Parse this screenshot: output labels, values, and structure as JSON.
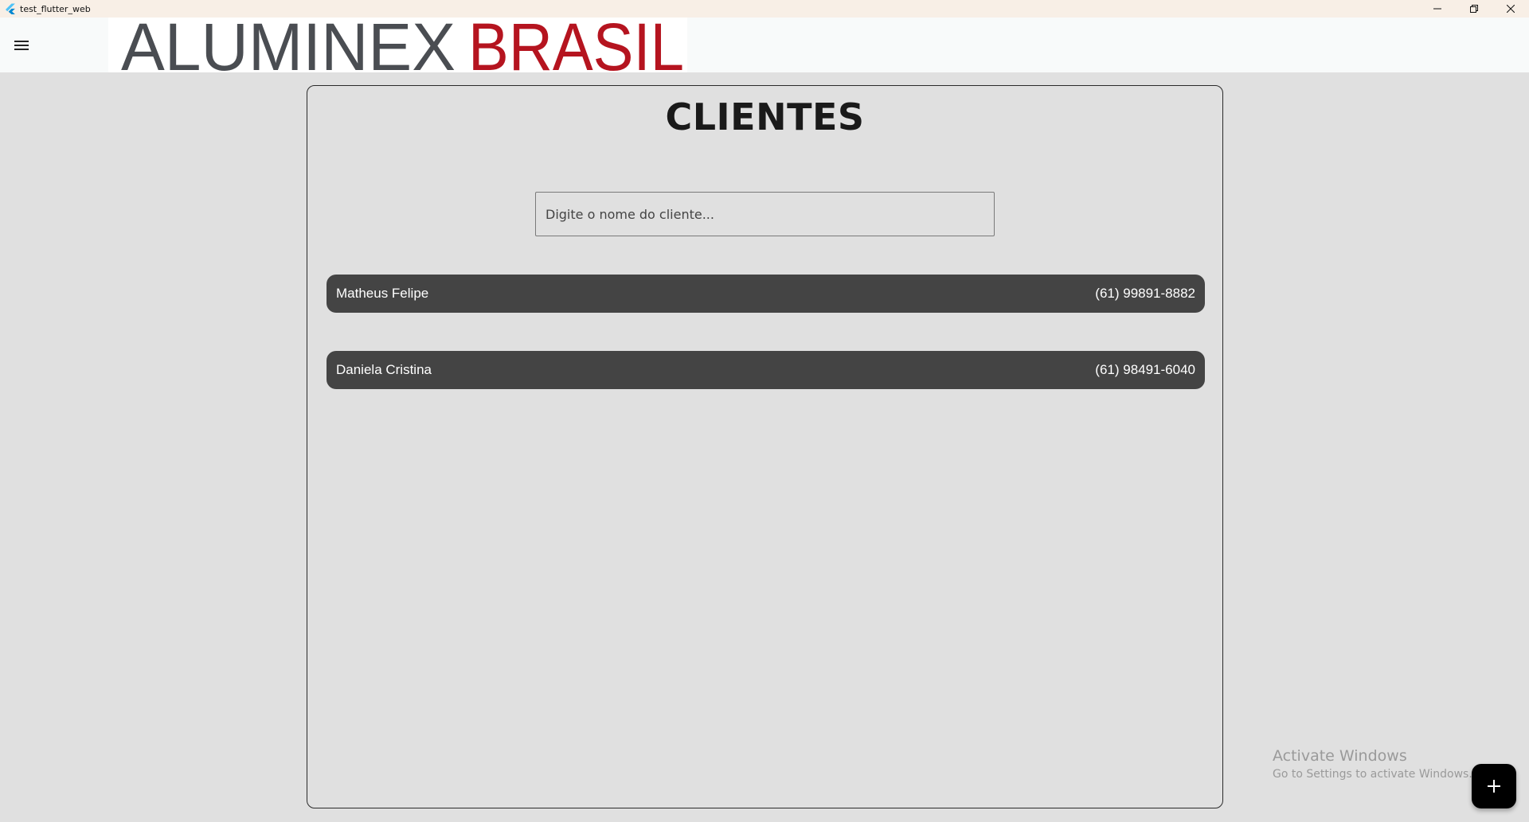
{
  "window": {
    "title": "test_flutter_web"
  },
  "appbar": {
    "menu_icon": "hamburger-menu-icon",
    "logo": {
      "part1": "ALUMINEX",
      "part2": "BRASIL",
      "color1": "#4a4d52",
      "color2": "#b5141f"
    }
  },
  "main": {
    "title": "CLIENTES",
    "search": {
      "placeholder": "Digite o nome do cliente...",
      "value": ""
    },
    "clients": [
      {
        "name": "Matheus Felipe",
        "phone": "(61) 99891-8882"
      },
      {
        "name": "Daniela Cristina",
        "phone": "(61) 98491-6040"
      }
    ]
  },
  "watermark": {
    "line1": "Activate Windows",
    "line2": "Go to Settings to activate Windows."
  },
  "fab": {
    "icon": "plus-icon"
  },
  "colors": {
    "background": "#e0e0e0",
    "row_bg": "#444444",
    "appbar_bg": "#f8fafa",
    "titlebar_bg": "#f8efe6"
  }
}
